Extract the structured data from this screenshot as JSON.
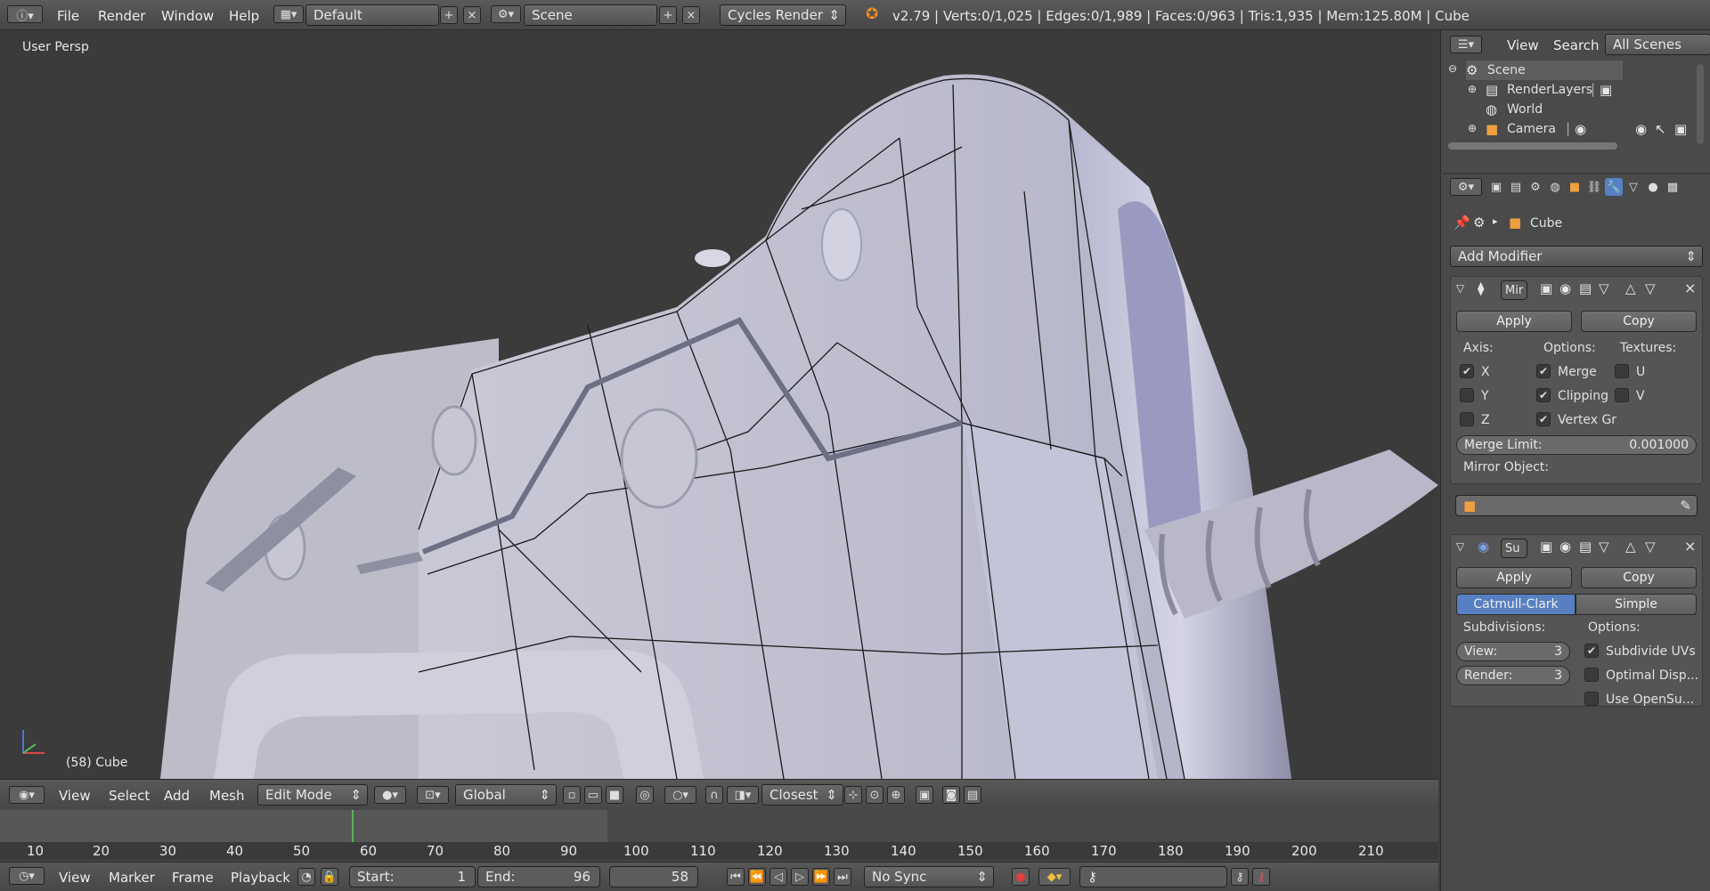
{
  "topbar": {
    "menus": [
      "File",
      "Render",
      "Window",
      "Help"
    ],
    "layout": "Default",
    "scene": "Scene",
    "engine": "Cycles Render",
    "stats": "v2.79 | Verts:0/1,025 | Edges:0/1,989 | Faces:0/963 | Tris:1,935 | Mem:125.80M | Cube"
  },
  "viewport": {
    "label": "User Persp",
    "object": "(58) Cube"
  },
  "vpheader": {
    "menus": [
      "View",
      "Select",
      "Add",
      "Mesh"
    ],
    "mode": "Edit Mode",
    "orientation": "Global",
    "snap": "Closest"
  },
  "timeline": {
    "ticks": [
      "10",
      "20",
      "30",
      "40",
      "50",
      "60",
      "70",
      "80",
      "90",
      "100",
      "110",
      "120",
      "130",
      "140",
      "150",
      "160",
      "170",
      "180",
      "190",
      "200",
      "210"
    ],
    "current_frame": 58
  },
  "tlbar": {
    "menus": [
      "View",
      "Marker",
      "Frame",
      "Playback"
    ],
    "start_label": "Start:",
    "start": "1",
    "end_label": "End:",
    "end": "96",
    "current": "58",
    "sync": "No Sync"
  },
  "outliner": {
    "menus": [
      "View",
      "Search"
    ],
    "filter": "All Scenes",
    "items": [
      "Scene",
      "RenderLayers",
      "World",
      "Camera"
    ]
  },
  "props": {
    "object": "Cube",
    "add_modifier": "Add Modifier",
    "mirror": {
      "name": "Mir",
      "apply": "Apply",
      "copy": "Copy",
      "axis_label": "Axis:",
      "options_label": "Options:",
      "textures_label": "Textures:",
      "axes": [
        "X",
        "Y",
        "Z"
      ],
      "axes_checked": [
        true,
        false,
        false
      ],
      "options": [
        "Merge",
        "Clipping",
        "Vertex Gr"
      ],
      "options_checked": [
        true,
        true,
        true
      ],
      "textures": [
        "U",
        "V"
      ],
      "merge_limit_label": "Merge Limit:",
      "merge_limit": "0.001000",
      "mirror_object_label": "Mirror Object:"
    },
    "subsurf": {
      "name": "Su",
      "apply": "Apply",
      "copy": "Copy",
      "tab1": "Catmull-Clark",
      "tab2": "Simple",
      "subdiv_label": "Subdivisions:",
      "options_label": "Options:",
      "view_label": "View:",
      "view": "3",
      "render_label": "Render:",
      "render": "3",
      "options": [
        "Subdivide UVs",
        "Optimal Disp...",
        "Use OpenSu..."
      ],
      "options_checked": [
        true,
        false,
        false
      ]
    }
  },
  "colors": {
    "accent": "#5680c2",
    "frame_line": "#5ab55a",
    "timeline_bg": "#444444"
  }
}
